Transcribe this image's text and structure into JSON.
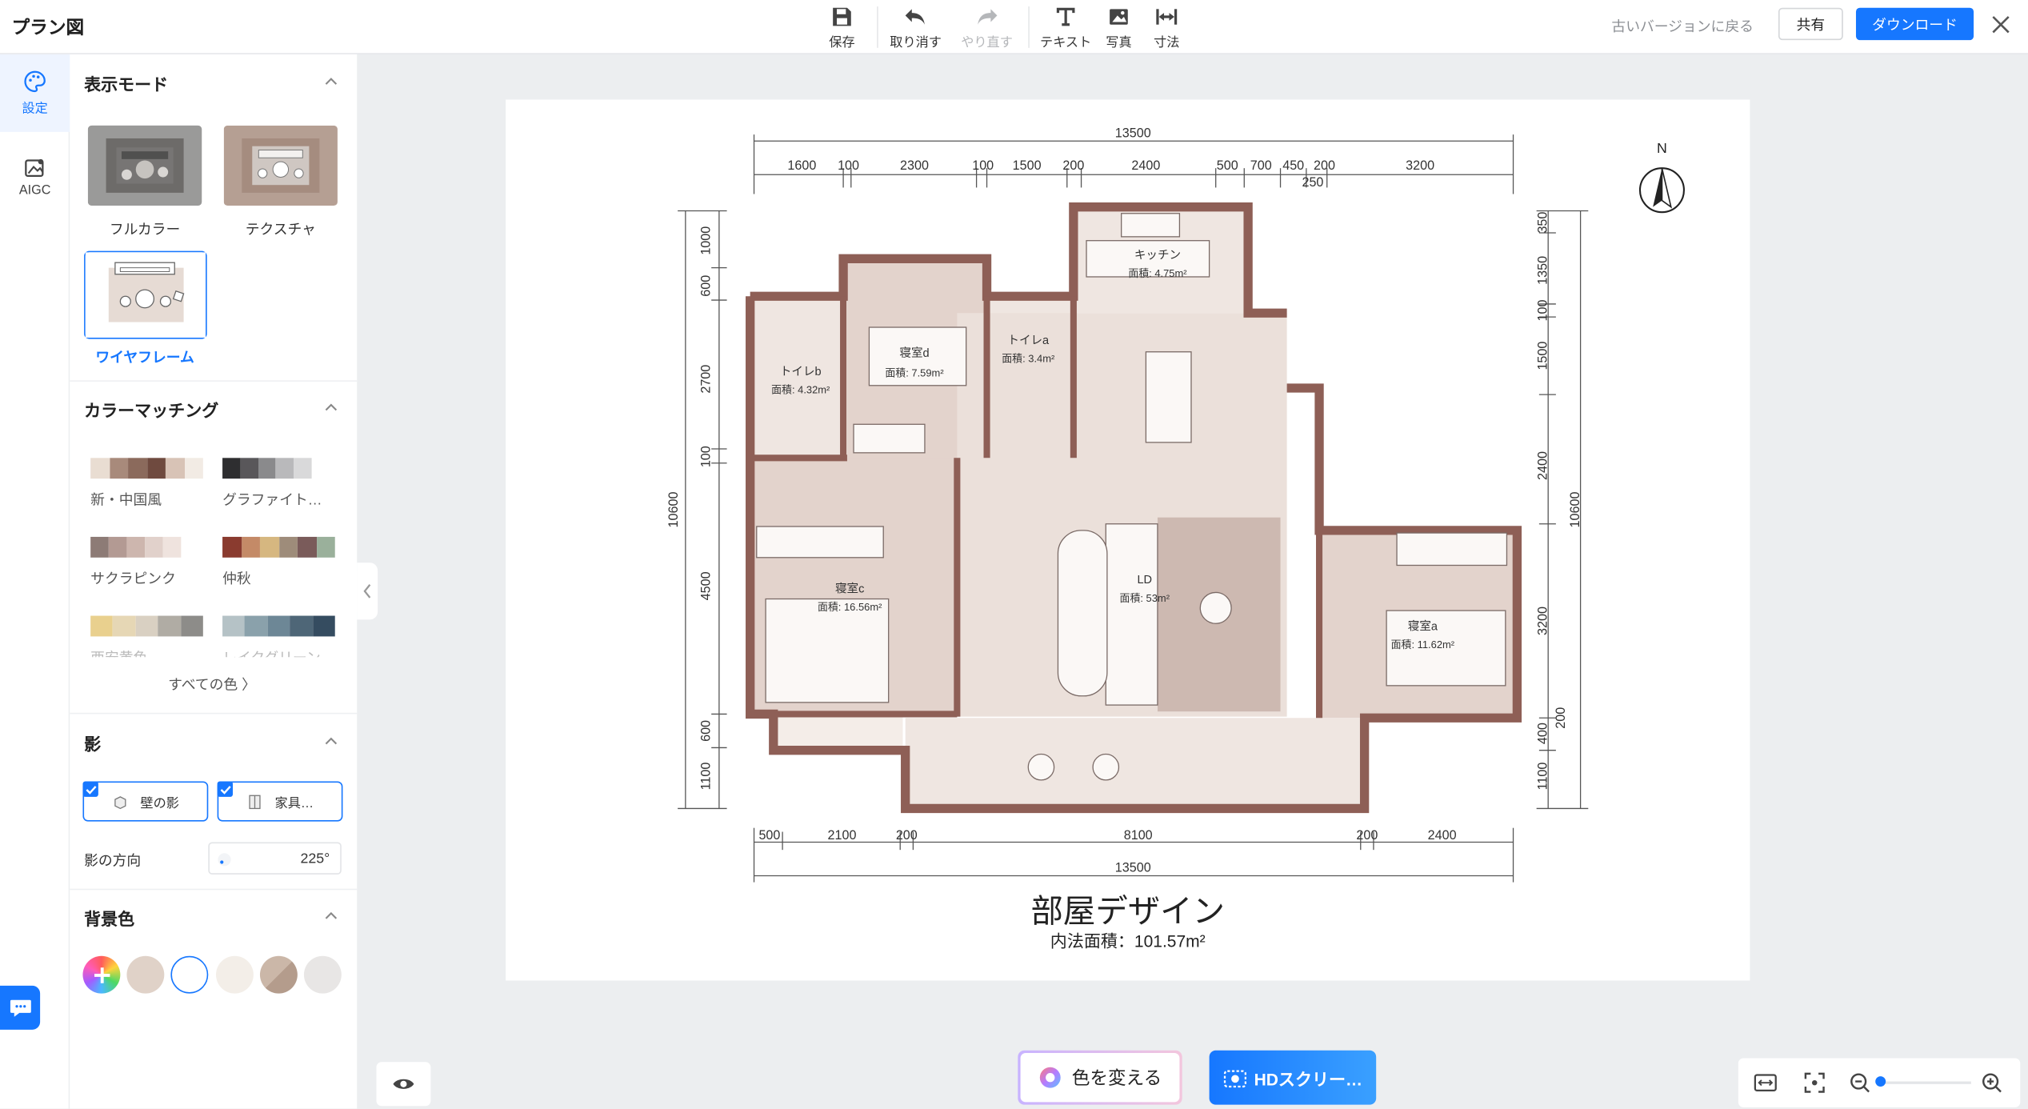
{
  "app": {
    "title": "プラン図"
  },
  "toolbar": {
    "save": "保存",
    "undo": "取り消す",
    "redo": "やり直す",
    "text": "テキスト",
    "photo": "写真",
    "dimension": "寸法"
  },
  "header_right": {
    "old_version": "古いバージョンに戻る",
    "share": "共有",
    "download": "ダウンロード"
  },
  "rail": {
    "settings": "設定",
    "aigc": "AIGC"
  },
  "panel": {
    "display_mode": {
      "heading": "表示モード",
      "options": [
        {
          "label": "フルカラー"
        },
        {
          "label": "テクスチャ"
        },
        {
          "label": "ワイヤフレーム",
          "selected": true
        }
      ]
    },
    "color_matching": {
      "heading": "カラーマッチング",
      "palettes": [
        {
          "label": "新・中国風",
          "colors": [
            "#e9ddd2",
            "#a88a7b",
            "#8b6a5c",
            "#6f4a3f",
            "#d8c3b6",
            "#f2ebe4"
          ]
        },
        {
          "label": "グラファイト…",
          "colors": [
            "#2e2e30",
            "#59575a",
            "#8a8a8c",
            "#b9b9bb",
            "#d9d9da"
          ]
        },
        {
          "label": "サクラピンク",
          "colors": [
            "#8d7b76",
            "#b39a93",
            "#cdb6ae",
            "#e1d1cb",
            "#efe3de"
          ]
        },
        {
          "label": "仲秋",
          "colors": [
            "#8a3b2f",
            "#c48a67",
            "#d6b780",
            "#9e8c7a",
            "#7a5b5a",
            "#9ab09b"
          ]
        },
        {
          "label": "西安黄色",
          "colors": [
            "#e9d08e",
            "#e6d7b5",
            "#d9d0c2",
            "#b0aca4",
            "#8d8c89"
          ]
        },
        {
          "label": "レイクグリーン",
          "colors": [
            "#b5c2c6",
            "#8aa1ab",
            "#6d8796",
            "#4e6677",
            "#354c60"
          ]
        }
      ],
      "all_colors": "すべての色 〉"
    },
    "shadow": {
      "heading": "影",
      "wall_shadow": "壁の影",
      "furniture_shadow": "家具…",
      "direction_label": "影の方向",
      "direction_value": "225°"
    },
    "background": {
      "heading": "背景色",
      "colors": [
        "#e0d2c8",
        "#ffffff",
        "#f3eee8",
        "#cbb7a8",
        "#e8e6e5"
      ]
    }
  },
  "plan": {
    "title": "部屋デザイン",
    "area": "内法面積：101.57m²",
    "compass": "N",
    "top_total": "13500",
    "bottom_total": "13500",
    "left_total": "10600",
    "right_total": "10600",
    "top_dims": [
      "1600",
      "100",
      "2300",
      "100",
      "1500",
      "200",
      "2400",
      "500",
      "700",
      "450",
      "200",
      "3200"
    ],
    "top_dim_extra": "250",
    "bottom_dims": [
      "500",
      "2100",
      "200",
      "8100",
      "200",
      "2400"
    ],
    "left_dims": [
      "1000",
      "600",
      "2700",
      "100",
      "4500",
      "600",
      "1100"
    ],
    "right_dims": [
      "350",
      "1350",
      "100",
      "1500",
      "2400",
      "3200",
      "400",
      "200",
      "1100"
    ],
    "rooms": [
      {
        "name": "キッチン",
        "area": "面積: 4.75m²"
      },
      {
        "name": "寝室d",
        "area": "面積: 7.59m²"
      },
      {
        "name": "トイレa",
        "area": "面積: 3.4m²"
      },
      {
        "name": "トイレb",
        "area": "面積: 4.32m²"
      },
      {
        "name": "寝室c",
        "area": "面積: 16.56m²"
      },
      {
        "name": "LD",
        "area": "面積: 53m²"
      },
      {
        "name": "寝室a",
        "area": "面積: 11.62m²"
      }
    ]
  },
  "bottom": {
    "change_color": "色を変える",
    "hd_screenshot": "HDスクリー…"
  },
  "colors": {
    "accent": "#1677ff",
    "wall": "#8e5f56",
    "floor": "#dccbc3"
  }
}
